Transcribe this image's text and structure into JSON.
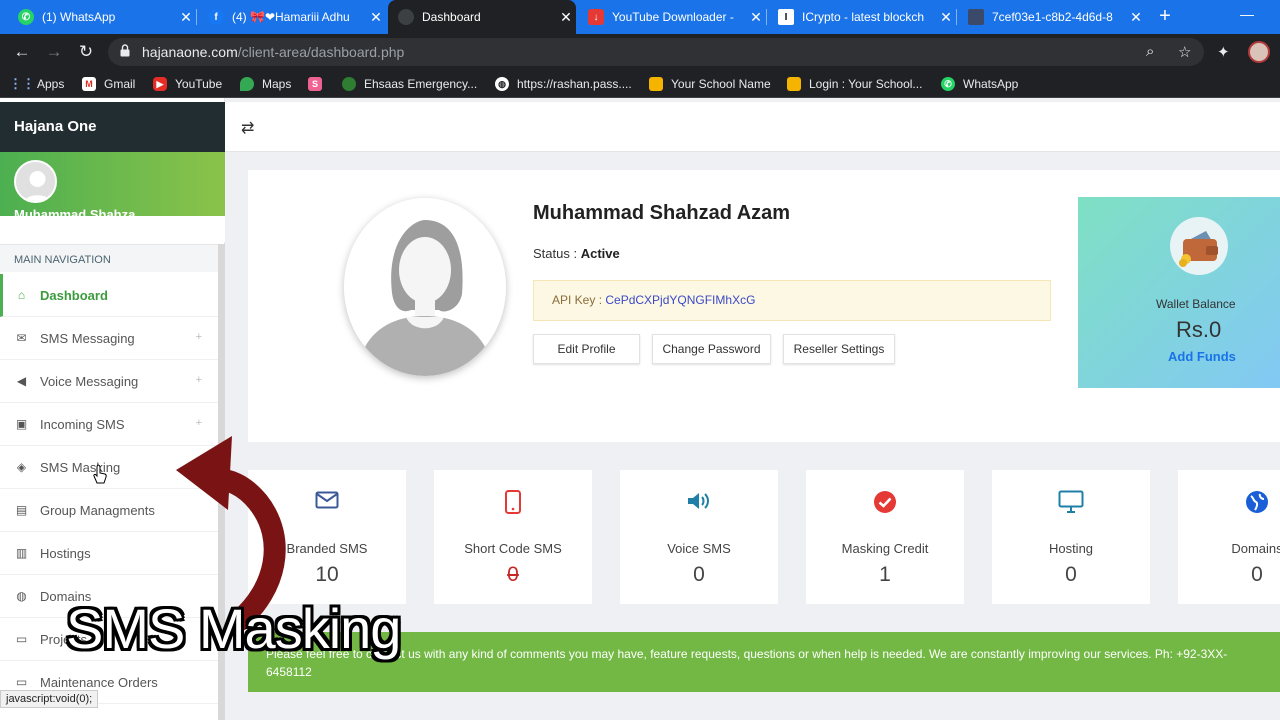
{
  "browser": {
    "tabs": [
      {
        "title": "(1) WhatsApp",
        "icon": "whatsapp-icon",
        "color": "#25d366"
      },
      {
        "title": "(4) 🎀❤Hamariii Adhu",
        "icon": "facebook-icon",
        "color": "#1877f2"
      },
      {
        "title": "Dashboard",
        "icon": "site-icon",
        "color": "#3c4043"
      },
      {
        "title": "YouTube Downloader -",
        "icon": "download-icon",
        "color": "#e53935"
      },
      {
        "title": "ICrypto - latest blockch",
        "icon": "icrypto-icon",
        "color": "#111111"
      },
      {
        "title": "7cef03e1-c8b2-4d6d-8",
        "icon": "document-icon",
        "color": "#3b4a6b"
      }
    ],
    "url_host": "hajanaone.com",
    "url_path": "/client-area/dashboard.php",
    "bookmarks": [
      {
        "label": "Apps",
        "icon": "apps-icon"
      },
      {
        "label": "Gmail",
        "icon": "gmail-icon"
      },
      {
        "label": "YouTube",
        "icon": "youtube-icon"
      },
      {
        "label": "Maps",
        "icon": "maps-icon"
      },
      {
        "label": "",
        "icon": "bookmark-icon"
      },
      {
        "label": "Ehsaas Emergency...",
        "icon": "ehsaas-icon"
      },
      {
        "label": "https://rashan.pass....",
        "icon": "globe-icon"
      },
      {
        "label": "Your School Name",
        "icon": "school-icon"
      },
      {
        "label": "Login : Your School...",
        "icon": "school-icon"
      },
      {
        "label": "WhatsApp",
        "icon": "whatsapp-icon"
      }
    ],
    "status_url": "javascript:void(0);"
  },
  "sidebar": {
    "brand": "Hajana One",
    "user_name": "Muhammad Shahza",
    "nav_header": "MAIN NAVIGATION",
    "items": [
      {
        "label": "Dashboard",
        "icon": "home-icon",
        "plus": ""
      },
      {
        "label": "SMS Messaging",
        "icon": "envelope-icon",
        "plus": "+"
      },
      {
        "label": "Voice Messaging",
        "icon": "volume-icon",
        "plus": "+"
      },
      {
        "label": "Incoming SMS",
        "icon": "inbox-icon",
        "plus": "+"
      },
      {
        "label": "SMS Masking",
        "icon": "layers-icon",
        "plus": ""
      },
      {
        "label": "Group Managments",
        "icon": "address-book-icon",
        "plus": ""
      },
      {
        "label": "Hostings",
        "icon": "server-icon",
        "plus": ""
      },
      {
        "label": "Domains",
        "icon": "globe-icon",
        "plus": ""
      },
      {
        "label": "Projects",
        "icon": "clipboard-icon",
        "plus": ""
      },
      {
        "label": "Maintenance Orders",
        "icon": "clipboard-icon",
        "plus": ""
      }
    ]
  },
  "profile": {
    "name": "Muhammad Shahzad Azam",
    "status_label": "Status : ",
    "status_value": "Active",
    "api_label": "API Key : ",
    "api_key": "CePdCXPjdYQNGFIMhXcG",
    "buttons": [
      "Edit Profile",
      "Change Password",
      "Reseller Settings"
    ]
  },
  "wallet": {
    "label": "Wallet Balance",
    "value": "Rs.0",
    "action": "Add Funds"
  },
  "stats": [
    {
      "label": "Branded SMS",
      "value": "10",
      "icon": "envelope-icon",
      "color": "#3b5998"
    },
    {
      "label": "Short Code SMS",
      "value": "0",
      "icon": "mobile-icon",
      "color": "#e53935"
    },
    {
      "label": "Voice SMS",
      "value": "0",
      "icon": "volume-icon",
      "color": "#1f7fa6"
    },
    {
      "label": "Masking Credit",
      "value": "1",
      "icon": "check-circle-icon",
      "color": "#e53935"
    },
    {
      "label": "Hosting",
      "value": "0",
      "icon": "monitor-icon",
      "color": "#1f7fa6"
    },
    {
      "label": "Domains",
      "value": "0",
      "icon": "globe-icon",
      "color": "#1a5fd8"
    }
  ],
  "banner": {
    "text": "Please feel free to contact us with any kind of comments you may have, feature requests, questions or when help is needed. We are constantly improving our services. Ph: +92-3XX-6458112"
  },
  "overlay": {
    "caption": "SMS Masking",
    "arrow_color": "#7a1414"
  }
}
